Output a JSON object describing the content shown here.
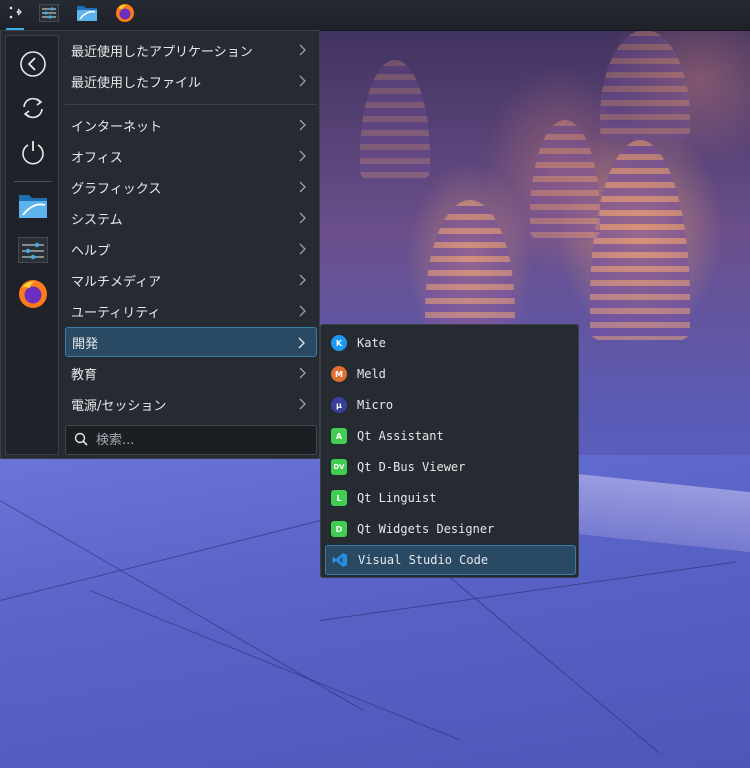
{
  "panel": {
    "icons": [
      "application-launcher-icon",
      "settings-sliders-icon",
      "file-manager-icon",
      "firefox-icon"
    ]
  },
  "sidebar": {
    "buttons": [
      "back-icon",
      "refresh-icon",
      "power-icon",
      "file-manager-icon",
      "settings-sliders-icon",
      "firefox-icon"
    ]
  },
  "menu": {
    "recent_apps": "最近使用したアプリケーション",
    "recent_files": "最近使用したファイル",
    "categories": [
      "インターネット",
      "オフィス",
      "グラフィックス",
      "システム",
      "ヘルプ",
      "マルチメディア",
      "ユーティリティ",
      "開発",
      "教育",
      "電源/セッション"
    ],
    "selected": "開発"
  },
  "search": {
    "placeholder": "検索..."
  },
  "submenu": {
    "items": [
      {
        "label": "Kate",
        "icon": "kate-icon",
        "badge": "K",
        "color": "#1d99f3"
      },
      {
        "label": "Meld",
        "icon": "meld-icon",
        "badge": "M",
        "color": "#e07030"
      },
      {
        "label": "Micro",
        "icon": "micro-icon",
        "badge": "µ",
        "color": "#3a3f9a"
      },
      {
        "label": "Qt Assistant",
        "icon": "qt-assistant-icon",
        "badge": "A",
        "color": "#41cd52"
      },
      {
        "label": "Qt D-Bus Viewer",
        "icon": "qt-dbus-viewer-icon",
        "badge": "DV",
        "color": "#41cd52"
      },
      {
        "label": "Qt Linguist",
        "icon": "qt-linguist-icon",
        "badge": "L",
        "color": "#41cd52"
      },
      {
        "label": "Qt Widgets Designer",
        "icon": "qt-designer-icon",
        "badge": "D",
        "color": "#41cd52"
      },
      {
        "label": "Visual Studio Code",
        "icon": "vscode-icon",
        "badge": "",
        "color": "#2b8fe0"
      }
    ],
    "selected": "Visual Studio Code"
  },
  "colors": {
    "accent": "#3daee9",
    "selection_bg": "#2a4a64",
    "menu_bg": "#262a31"
  }
}
